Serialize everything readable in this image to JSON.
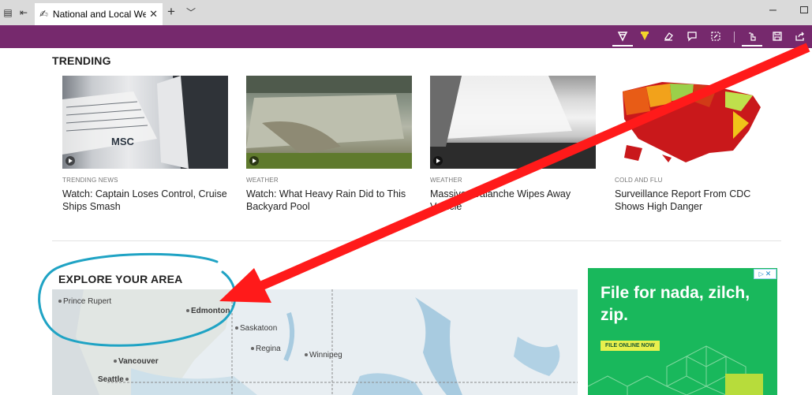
{
  "browser": {
    "tab_title": "National and Local Wea",
    "icons": [
      "tab-preview-icon",
      "set-aside-icon",
      "pen-icon",
      "close-icon",
      "new-tab-icon",
      "chevron-down-icon",
      "minimize-icon",
      "restore-icon"
    ]
  },
  "note_toolbar": {
    "tools": [
      "pen",
      "highlighter",
      "eraser",
      "add-note",
      "clip",
      "touch-write",
      "save",
      "share"
    ],
    "accent": "#76296d"
  },
  "trending": {
    "title": "TRENDING",
    "cards": [
      {
        "category": "TRENDING NEWS",
        "headline": "Watch: Captain Loses Control, Cruise Ships Smash",
        "thumb_overlay": "MSC"
      },
      {
        "category": "WEATHER",
        "headline": "Watch: What Heavy Rain Did to This Backyard Pool"
      },
      {
        "category": "WEATHER",
        "headline": "Massive Avalanche Wipes Away Vehicle"
      },
      {
        "category": "COLD AND FLU",
        "headline": "Surveillance Report From CDC Shows High Danger"
      }
    ]
  },
  "explore": {
    "title": "EXPLORE YOUR AREA",
    "map_labels": [
      "Prince Rupert",
      "Edmonton",
      "Saskatoon",
      "Regina",
      "Winnipeg",
      "Vancouver",
      "Seattle"
    ]
  },
  "ad": {
    "headline": "File for nada, zilch, zip.",
    "cta": "FILE ONLINE NOW",
    "choices_icon": "adchoices-icon",
    "close_icon": "close-icon",
    "brand_color": "#19b85c"
  },
  "annotation": {
    "arrow_color": "#ff1a1a",
    "circle_color": "#1fa3c4"
  }
}
